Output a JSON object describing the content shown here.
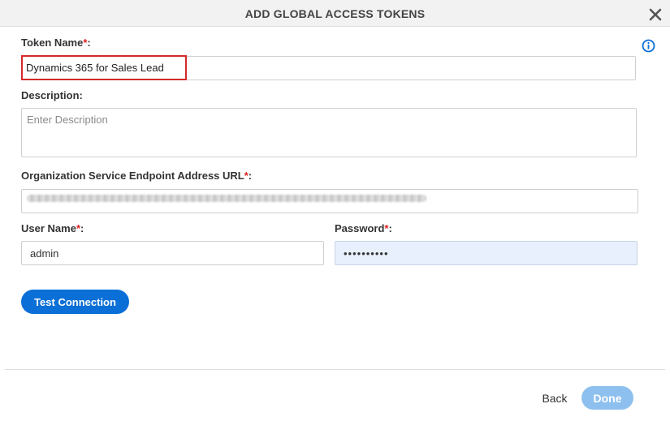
{
  "dialog": {
    "title": "ADD GLOBAL ACCESS TOKENS",
    "close_icon": "close-icon",
    "info_icon": "info-icon"
  },
  "form": {
    "token_name": {
      "label": "Token Name",
      "required_mark": "*",
      "colon": ":",
      "value": "Dynamics 365 for Sales Lead"
    },
    "description": {
      "label": "Description:",
      "value": "",
      "placeholder": "Enter Description"
    },
    "endpoint_url": {
      "label": "Organization Service Endpoint Address URL",
      "required_mark": "*",
      "colon": ":"
    },
    "user_name": {
      "label": "User Name",
      "required_mark": "*",
      "colon": ":",
      "value": "admin"
    },
    "password": {
      "label": "Password",
      "required_mark": "*",
      "colon": ":",
      "value": "••••••••••"
    }
  },
  "buttons": {
    "test_connection": "Test Connection",
    "back": "Back",
    "done": "Done"
  },
  "colors": {
    "primary": "#0a6fd6",
    "primary_disabled": "#8dc0ee",
    "required": "#e02020",
    "highlight": "#d42a2a",
    "autofill": "#e8f0fe"
  }
}
